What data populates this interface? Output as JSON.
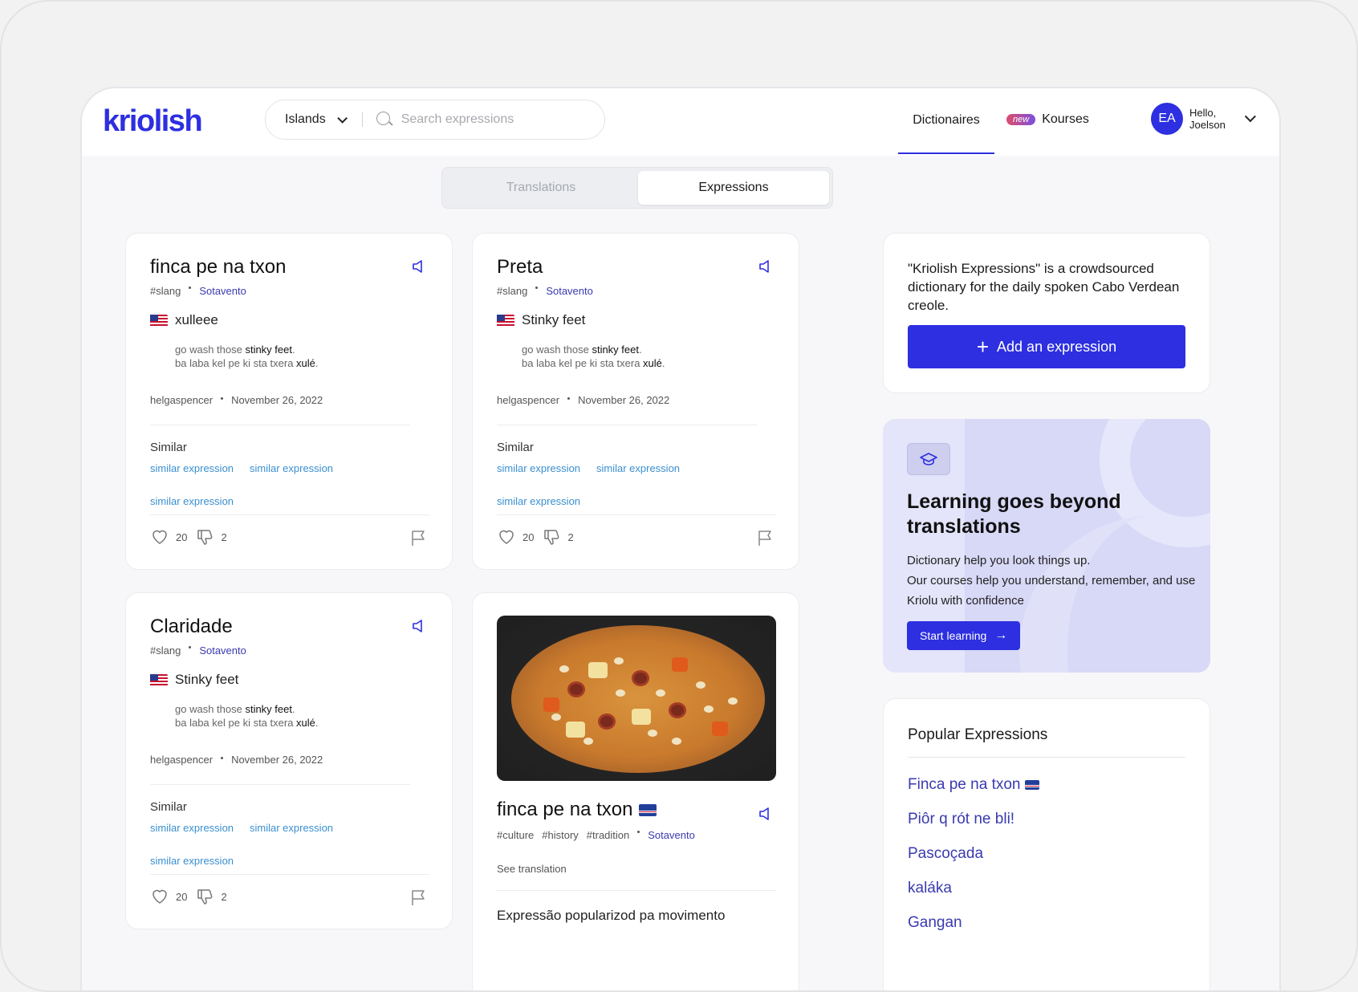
{
  "header": {
    "logo": "kriolish",
    "islands_label": "Islands",
    "search_placeholder": "Search expressions",
    "nav_dictionaries": "Dictionaires",
    "nav_new_badge": "new",
    "nav_kourses": "Kourses",
    "avatar_initials": "EA",
    "greeting": "Hello, Joelson"
  },
  "tabs": {
    "translations": "Translations",
    "expressions": "Expressions",
    "active": "Expressions"
  },
  "cards": [
    {
      "title": "finca pe na txon",
      "tag": "#slang",
      "region": "Sotavento",
      "translation": "xulleee",
      "example_en_pre": "go wash those ",
      "example_en_bold": "stinky feet",
      "example_en_post": ".",
      "example_kr_pre": "ba laba kel pe ki sta txera ",
      "example_kr_bold": "xulé",
      "example_kr_post": ".",
      "author": "helgaspencer",
      "date": "November 26, 2022",
      "similar_label": "Similar",
      "similar": [
        "similar expression",
        "similar expression",
        "similar expression"
      ],
      "likes": "20",
      "dislikes": "2"
    },
    {
      "title": "Preta",
      "tag": "#slang",
      "region": "Sotavento",
      "translation": "Stinky feet",
      "example_en_pre": "go wash those ",
      "example_en_bold": "stinky feet",
      "example_en_post": ".",
      "example_kr_pre": "ba laba kel pe ki sta txera ",
      "example_kr_bold": "xulé",
      "example_kr_post": ".",
      "author": "helgaspencer",
      "date": "November 26, 2022",
      "similar_label": "Similar",
      "similar": [
        "similar expression",
        "similar expression",
        "similar expression"
      ],
      "likes": "20",
      "dislikes": "2"
    },
    {
      "title": "Claridade",
      "tag": "#slang",
      "region": "Sotavento",
      "translation": "Stinky feet",
      "example_en_pre": "go wash those ",
      "example_en_bold": "stinky feet",
      "example_en_post": ".",
      "example_kr_pre": "ba laba kel pe ki sta txera ",
      "example_kr_bold": "xulé",
      "example_kr_post": ".",
      "author": "helgaspencer",
      "date": "November 26, 2022",
      "similar_label": "Similar",
      "similar": [
        "similar expression",
        "similar expression",
        "similar expression"
      ],
      "likes": "20",
      "dislikes": "2"
    }
  ],
  "image_card": {
    "title": "finca pe na txon",
    "tags": [
      "#culture",
      "#history",
      "#tradition"
    ],
    "region": "Sotavento",
    "see_translation": "See translation",
    "description": "Expressão popularizod pa movimento"
  },
  "sidebar": {
    "info_text": "\"Kriolish Expressions\" is a crowdsourced dictionary for the daily spoken Cabo Verdean creole.",
    "add_button": "Add an expression",
    "learn_title": "Learning goes beyond translations",
    "learn_line1": "Dictionary help you look things up.",
    "learn_line2": "Our courses help you understand, remember, and use Kriolu with confidence",
    "start_button": "Start learning",
    "popular_title": "Popular Expressions",
    "popular": [
      "Finca pe na txon",
      "Piôr q rót ne bli!",
      "Pascoçada",
      "kaláka",
      "Gangan"
    ]
  },
  "colors": {
    "brand": "#2d2fe0",
    "link": "#3a8fd0",
    "region": "#3a3ab0",
    "learn_bg": "#e4e4fa"
  }
}
